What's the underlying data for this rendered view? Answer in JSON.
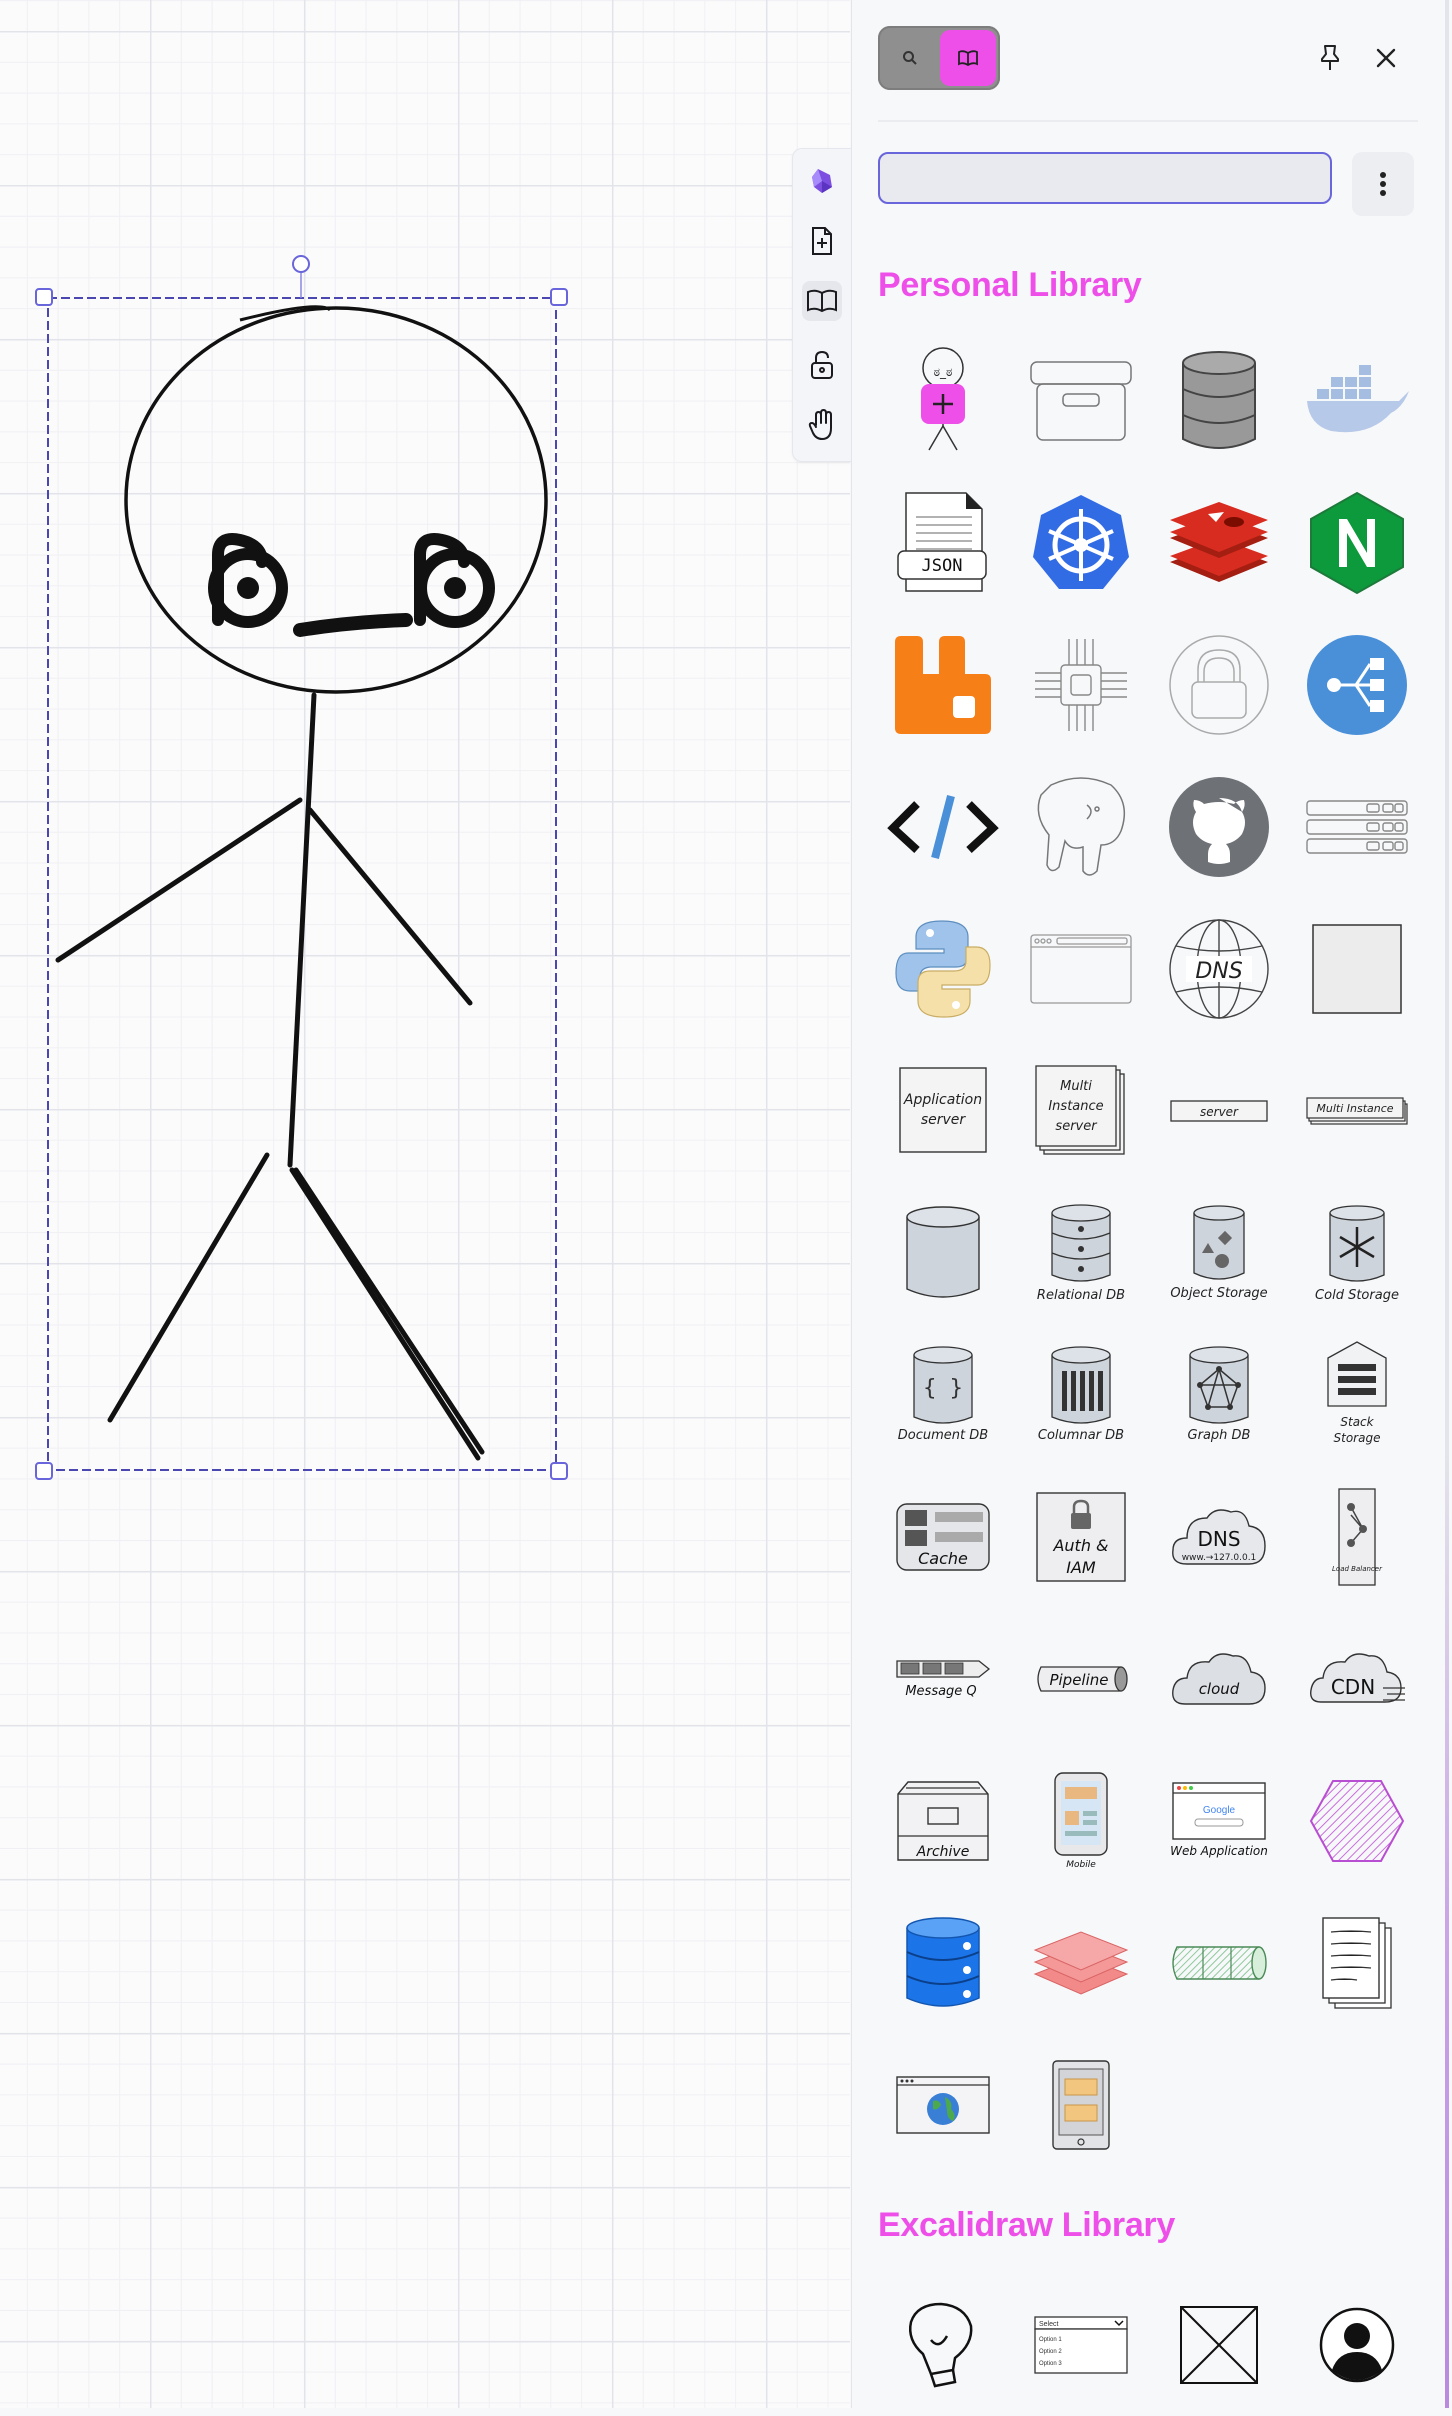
{
  "canvas": {
    "selected_element": "stick figure"
  },
  "toolbar": {
    "items": [
      {
        "name": "obsidian",
        "icon": "obsidian-gem-icon",
        "active": false
      },
      {
        "name": "new-file",
        "icon": "file-plus-icon",
        "active": false
      },
      {
        "name": "library",
        "icon": "open-book-icon",
        "active": true
      },
      {
        "name": "unlock",
        "icon": "unlock-icon",
        "active": false
      },
      {
        "name": "hand",
        "icon": "hand-icon",
        "active": false
      }
    ]
  },
  "sidebar": {
    "tabs": [
      {
        "name": "search",
        "icon": "search-icon",
        "active": false
      },
      {
        "name": "library",
        "icon": "book-icon",
        "active": true
      }
    ],
    "pin_icon": "pin-icon",
    "close_icon": "close-icon",
    "search": {
      "placeholder": "",
      "value": ""
    },
    "more_icon": "more-vertical-icon",
    "accent_color": "#ee4fe9",
    "personal_library": {
      "title": "Personal Library",
      "item_labels": {
        "json": "JSON",
        "app_server_1": "Application",
        "app_server_2": "server",
        "multi_1": "Multi",
        "multi_2": "Instance",
        "multi_3": "server",
        "server": "server",
        "multi_instance": "Multi Instance",
        "relational_db": "Relational DB",
        "object_storage": "Object Storage",
        "cold_storage": "Cold Storage",
        "document_db": "Document DB",
        "columnar_db": "Columnar DB",
        "graph_db": "Graph DB",
        "stack_1": "Stack",
        "stack_2": "Storage",
        "cache": "Cache",
        "auth_1": "Auth &",
        "auth_2": "IAM",
        "dns": "DNS",
        "dns_sub": "www.→127.0.0.1",
        "load_balancer": "Load Balancer",
        "message_q": "Message Q",
        "pipeline": "Pipeline",
        "cloud": "cloud",
        "cdn": "CDN",
        "archive": "Archive",
        "mobile": "Mobile",
        "web_app": "Web Application",
        "google": "Google",
        "dns_globe": "DNS"
      }
    },
    "excalidraw_library": {
      "title": "Excalidraw Library",
      "item_labels": {
        "select": "Select",
        "opt1": "Option 1",
        "opt2": "Option 2",
        "opt3": "Option 3"
      }
    }
  }
}
